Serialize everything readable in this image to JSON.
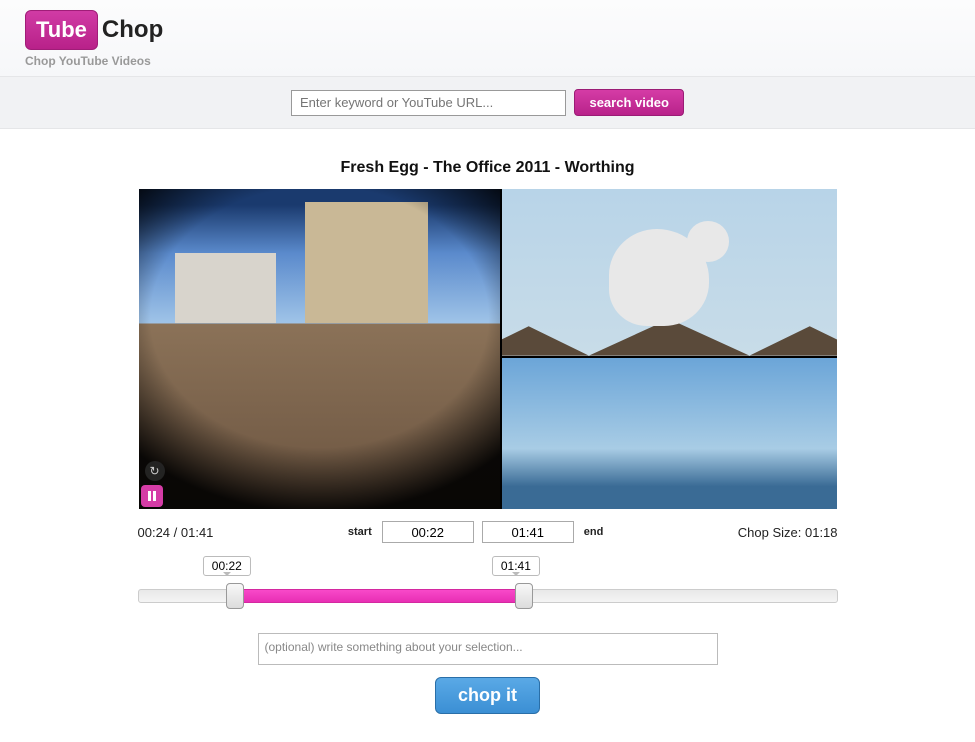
{
  "logo": {
    "tube": "Tube",
    "chop": "Chop"
  },
  "tagline": "Chop YouTube Videos",
  "search": {
    "placeholder": "Enter keyword or YouTube URL...",
    "button": "search video"
  },
  "video": {
    "title": "Fresh Egg - The Office 2011 - Worthing"
  },
  "player": {
    "current_time": "00:24",
    "total_time": "01:41",
    "time_display": "00:24 / 01:41"
  },
  "chop": {
    "start_label": "start",
    "end_label": "end",
    "start_value": "00:22",
    "end_value": "01:41",
    "size_label": "Chop Size: 01:18"
  },
  "slider": {
    "start_label": "00:22",
    "end_label": "01:41",
    "start_pct": 13.9,
    "end_pct": 55.2
  },
  "description": {
    "placeholder": "(optional) write something about your selection..."
  },
  "chop_button": "chop it"
}
